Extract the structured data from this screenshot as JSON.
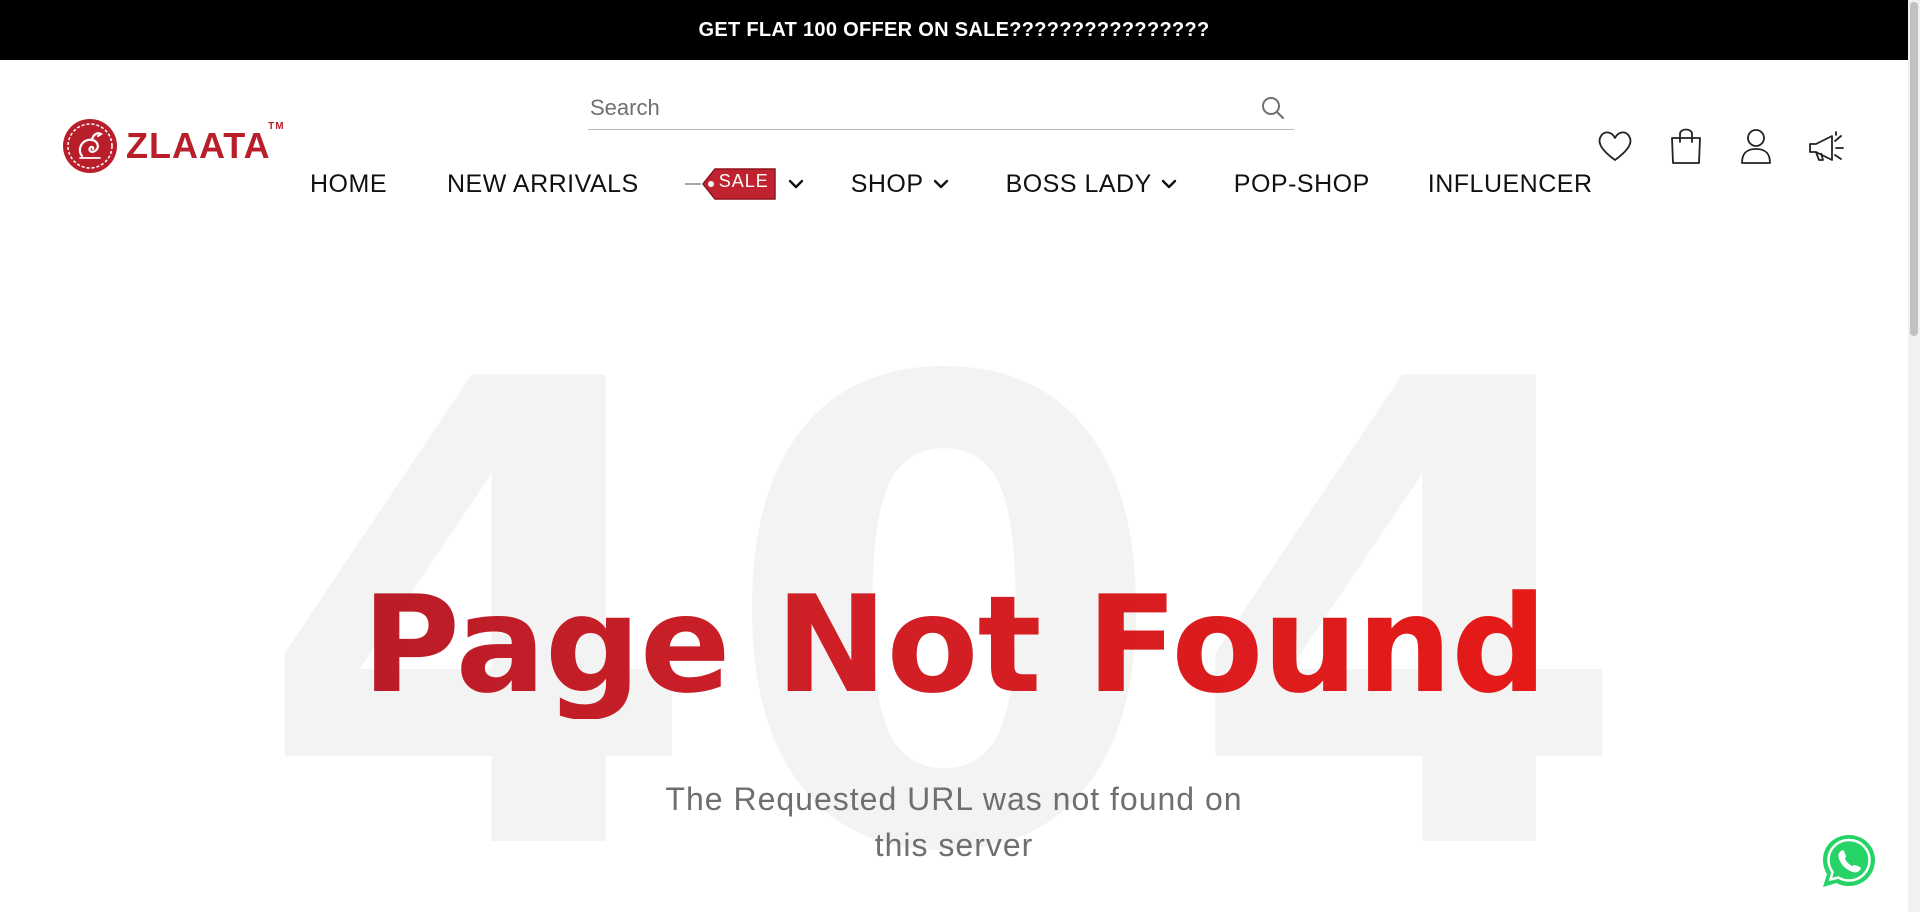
{
  "announcement": {
    "text": "GET FLAT 100 OFFER ON SALE????????????????"
  },
  "brand": {
    "name": "ZLAATA",
    "trademark": "TM",
    "color": "#b81f2a"
  },
  "search": {
    "placeholder": "Search",
    "value": ""
  },
  "nav": {
    "items": [
      {
        "label": "HOME",
        "has_dropdown": false
      },
      {
        "label": "NEW ARRIVALS",
        "has_dropdown": false
      },
      {
        "label": "SALE",
        "has_dropdown": true,
        "style": "tag"
      },
      {
        "label": "SHOP",
        "has_dropdown": true
      },
      {
        "label": "BOSS LADY",
        "has_dropdown": true
      },
      {
        "label": "POP-SHOP",
        "has_dropdown": false
      },
      {
        "label": "INFLUENCER",
        "has_dropdown": false
      }
    ]
  },
  "header_icons": [
    "heart-icon",
    "shopping-bag-icon",
    "user-icon",
    "megaphone-icon"
  ],
  "error": {
    "code": "404",
    "title": "Page Not Found",
    "message_line1": "The Requested URL was not found on",
    "message_line2": "this server"
  },
  "colors": {
    "accent": "#d01f26",
    "sale_tag": "#c1222f",
    "whatsapp": "#25d366"
  }
}
